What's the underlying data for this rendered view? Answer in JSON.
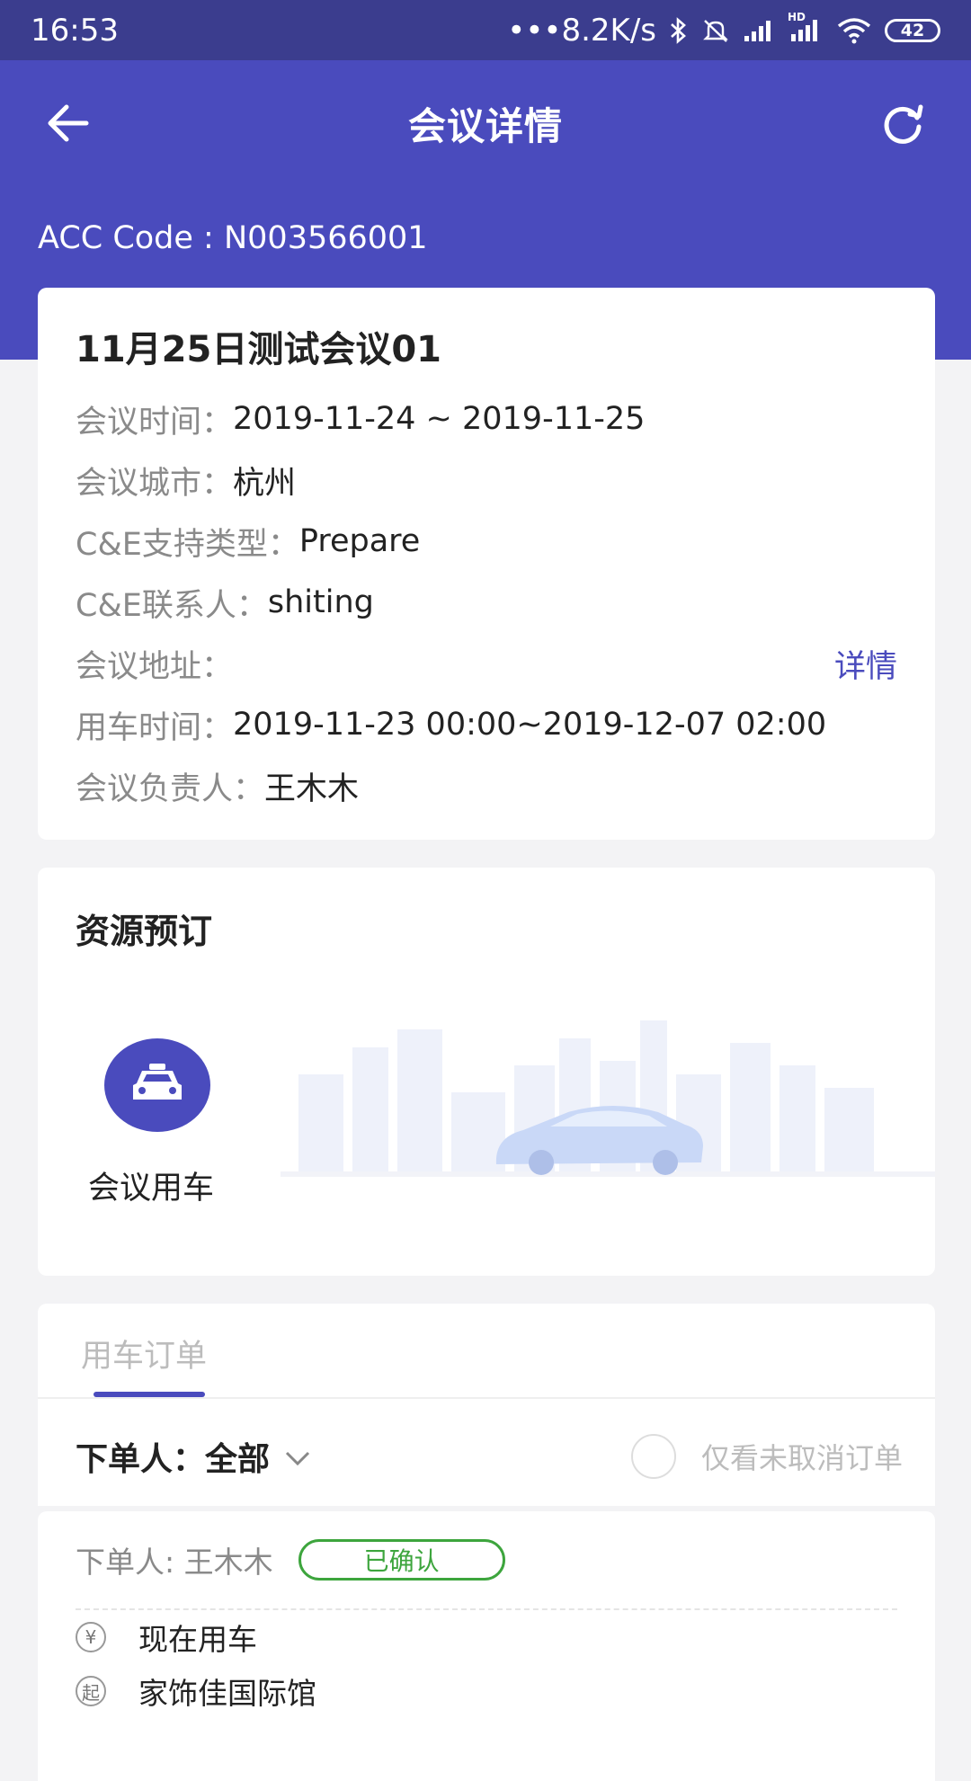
{
  "status_bar": {
    "time": "16:53",
    "network_speed": "•••8.2K/s",
    "hd_label": "HD",
    "battery": "42"
  },
  "nav": {
    "title": "会议详情"
  },
  "acc_code": "ACC Code : N003566001",
  "meeting": {
    "title": "11月25日测试会议01",
    "rows": [
      {
        "label": "会议时间：",
        "value": "2019-11-24 ~ 2019-11-25"
      },
      {
        "label": "会议城市：",
        "value": "杭州"
      },
      {
        "label": "C&E支持类型：",
        "value": "Prepare"
      },
      {
        "label": "C&E联系人：",
        "value": "shiting"
      },
      {
        "label": "会议地址：",
        "value": "",
        "link": "详情"
      },
      {
        "label": "用车时间：",
        "value": "2019-11-23 00:00~2019-12-07 02:00"
      },
      {
        "label": "会议负责人：",
        "value": "王木木"
      }
    ]
  },
  "resource": {
    "title": "资源预订",
    "car_label": "会议用车"
  },
  "orders_tab": {
    "label": "用车订单",
    "filter_label": "下单人：",
    "filter_value": "全部",
    "only_uncancelled": "仅看未取消订单"
  },
  "order": {
    "orderer": "下单人: 王木木",
    "status": "已确认",
    "lines": [
      {
        "icon_text": "¥",
        "icon": "yuan-icon",
        "text": "现在用车"
      },
      {
        "icon_text": "起",
        "icon": "start-icon",
        "text": "家饰佳国际馆"
      }
    ]
  },
  "colors": {
    "accent": "#4a4bbd",
    "status_bar": "#3b3d8e",
    "confirmed": "#3da53d"
  }
}
